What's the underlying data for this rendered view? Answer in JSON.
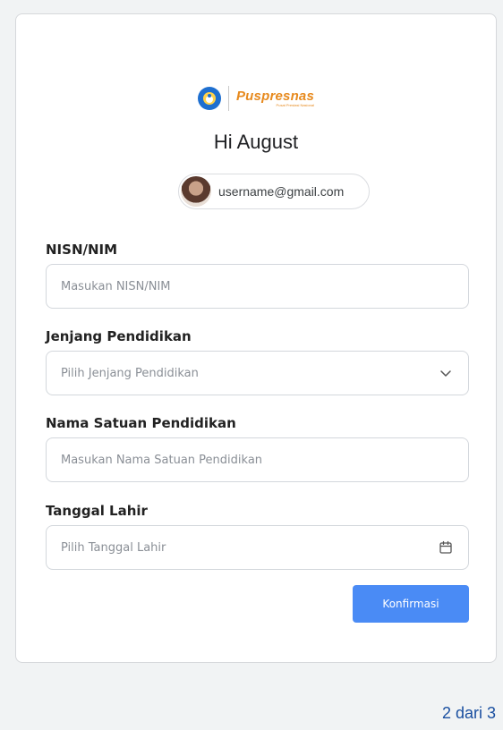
{
  "logo": {
    "wordmark": "Puspresnas",
    "subtitle": "Pusat Prestasi Nasional"
  },
  "greeting": "Hi August",
  "account": {
    "email": "username@gmail.com"
  },
  "form": {
    "nisn": {
      "label": "NISN/NIM",
      "placeholder": "Masukan NISN/NIM"
    },
    "jenjang": {
      "label": "Jenjang Pendidikan",
      "placeholder": "Pilih Jenjang Pendidikan",
      "icon": "chevron-down-icon"
    },
    "satuan": {
      "label": "Nama Satuan Pendidikan",
      "placeholder": "Masukan Nama Satuan Pendidikan"
    },
    "tanggal": {
      "label": "Tanggal Lahir",
      "placeholder": "Pilih Tanggal Lahir",
      "icon": "calendar-icon"
    },
    "submit_label": "Konfirmasi"
  },
  "pagination": "2 dari 3",
  "colors": {
    "accent": "#4a8bf5",
    "brand": "#e78a1e",
    "pagination": "#1a4fa0"
  }
}
